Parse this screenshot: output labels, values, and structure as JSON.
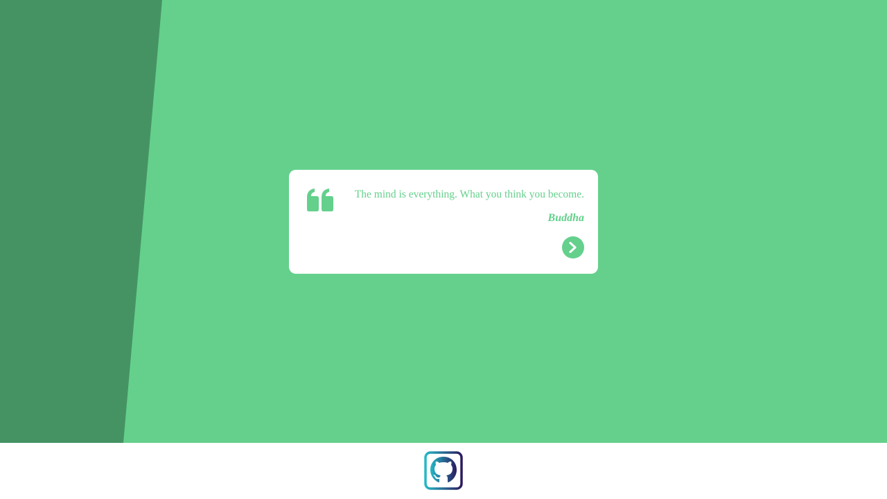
{
  "colors": {
    "accent": "#64d08c",
    "accent_dark": "#459363",
    "card_background": "#ffffff",
    "footer_background": "#ffffff",
    "github_gradient_start": "#25b8c7",
    "github_gradient_end": "#2b1a5e"
  },
  "quote": {
    "text": "The mind is everything. What you think you become.",
    "author": "Buddha"
  },
  "icons": {
    "quote": "quote-left-icon",
    "next": "chevron-right-icon",
    "github": "github-icon"
  }
}
